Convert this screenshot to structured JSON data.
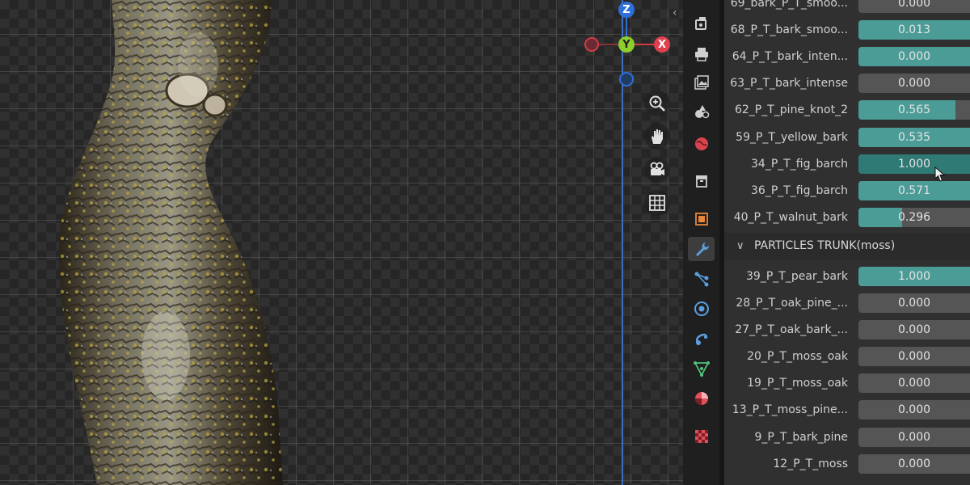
{
  "viewport": {
    "gizmo": {
      "x_label": "X",
      "y_label": "Y",
      "z_label": "Z"
    },
    "nav_buttons": [
      "zoom-icon",
      "hand-pan-icon",
      "camera-icon",
      "grid-icon"
    ]
  },
  "tabs": [
    {
      "name": "render-tab",
      "icon": "render-icon",
      "color": "#cfcfcf",
      "active": false
    },
    {
      "name": "output-tab",
      "icon": "printer-icon",
      "color": "#cfcfcf",
      "active": false
    },
    {
      "name": "view-layer-tab",
      "icon": "image-stack-icon",
      "color": "#cfcfcf",
      "active": false
    },
    {
      "name": "scene-tab",
      "icon": "scene-icon",
      "color": "#cfcfcf",
      "active": false
    },
    {
      "name": "world-tab",
      "icon": "world-icon",
      "color": "#d9434e",
      "active": false
    },
    {
      "name": "collection-tab",
      "icon": "box-icon",
      "color": "#cfcfcf",
      "active": false
    },
    {
      "name": "object-tab",
      "icon": "object-icon",
      "color": "#e8863a",
      "active": false
    },
    {
      "name": "modifier-tab",
      "icon": "wrench-icon",
      "color": "#5a9fe0",
      "active": true
    },
    {
      "name": "particles-tab",
      "icon": "particles-icon",
      "color": "#5a9fe0",
      "active": false
    },
    {
      "name": "physics-tab",
      "icon": "physics-icon",
      "color": "#5a9fe0",
      "active": false
    },
    {
      "name": "constraints-tab",
      "icon": "constraint-icon",
      "color": "#5a9fe0",
      "active": false
    },
    {
      "name": "data-tab",
      "icon": "mesh-data-icon",
      "color": "#4fc47a",
      "active": false
    },
    {
      "name": "material-tab",
      "icon": "material-icon",
      "color": "#e0505a",
      "active": false
    },
    {
      "name": "texture-tab",
      "icon": "checker-icon",
      "color": "#e0505a",
      "active": false
    }
  ],
  "properties": {
    "rows_top": [
      {
        "label": "69_bark_P_T_smoo...",
        "value": "0.000",
        "fraction": 0.0
      },
      {
        "label": "68_P_T_bark_smoo...",
        "value": "0.013",
        "fraction": 1.0
      },
      {
        "label": "64_P_T_bark_inten...",
        "value": "0.000",
        "fraction": 1.0
      },
      {
        "label": "63_P_T_bark_intense",
        "value": "0.000",
        "fraction": 0.0
      },
      {
        "label": "62_P_T_pine_knot_2",
        "value": "0.565",
        "fraction": 0.8
      },
      {
        "label": "59_P_T_yellow_bark",
        "value": "0.535",
        "fraction": 1.0
      },
      {
        "label": "34_P_T_fig_barch",
        "value": "1.000",
        "fraction": 1.0,
        "active": true
      },
      {
        "label": "36_P_T_fig_barch",
        "value": "0.571",
        "fraction": 1.0
      },
      {
        "label": "40_P_T_walnut_bark",
        "value": "0.296",
        "fraction": 0.36
      }
    ],
    "section": {
      "title": "PARTICLES TRUNK(moss)"
    },
    "rows_section": [
      {
        "label": "39_P_T_pear_bark",
        "value": "1.000",
        "fraction": 1.0
      },
      {
        "label": "28_P_T_oak_pine_...",
        "value": "0.000",
        "fraction": 0.0
      },
      {
        "label": "27_P_T_oak_bark_...",
        "value": "0.000",
        "fraction": 0.0
      },
      {
        "label": "20_P_T_moss_oak",
        "value": "0.000",
        "fraction": 0.0
      },
      {
        "label": "19_P_T_moss_oak",
        "value": "0.000",
        "fraction": 0.0
      },
      {
        "label": "13_P_T_moss_pine...",
        "value": "0.000",
        "fraction": 0.0
      },
      {
        "label": "9_P_T_bark_pine",
        "value": "0.000",
        "fraction": 0.0
      },
      {
        "label": "12_P_T_moss",
        "value": "0.000",
        "fraction": 0.0
      }
    ]
  }
}
